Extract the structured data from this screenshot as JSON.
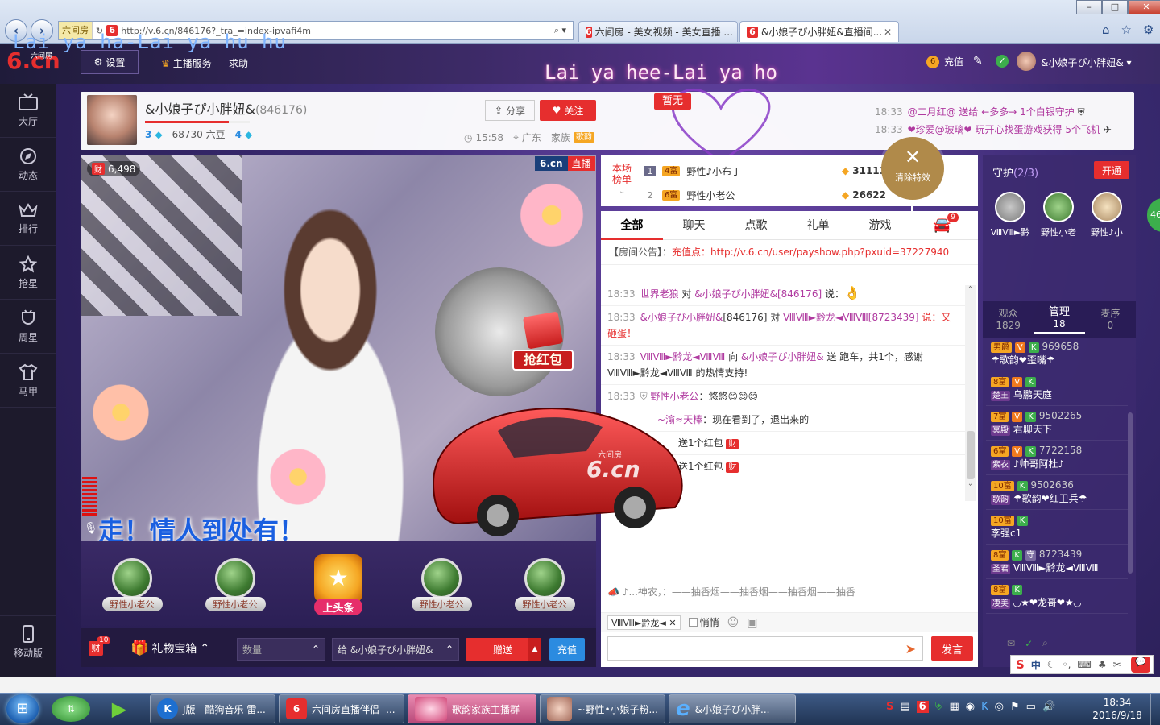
{
  "browser": {
    "address": "http://v.6.cn/846176?_tra_=index-ipvafi4m",
    "badge": "六间房",
    "tabs": [
      {
        "label": "六间房 - 美女视频 - 美女直播 ..."
      },
      {
        "label": "&小娘子ぴ小胖妞&直播间..."
      }
    ]
  },
  "lyrics": {
    "line1": "Lai ya ha-Lai ya hu hu",
    "line2": "Lai ya hee-Lai ya ho"
  },
  "site": {
    "logo_small": "六间房",
    "logo": "6.cn",
    "settings": "设置",
    "anchor_service": "主播服务",
    "help": "求助",
    "recharge": "充值",
    "user": "&小娘子ぴ小胖妞&"
  },
  "leftnav": [
    {
      "label": "大厅",
      "icon": "tv-icon"
    },
    {
      "label": "动态",
      "icon": "compass-icon"
    },
    {
      "label": "排行",
      "icon": "crown-icon"
    },
    {
      "label": "抢星",
      "icon": "star-icon"
    },
    {
      "label": "周星",
      "icon": "cup-icon"
    },
    {
      "label": "马甲",
      "icon": "shirt-icon"
    }
  ],
  "mobile": "移动版",
  "anchor": {
    "name": "&小娘子ぴ小胖妞&",
    "room": "(846176)",
    "level1": "3",
    "beans": "68730 六豆",
    "level2": "4",
    "share": "分享",
    "follow": "关注",
    "time": "15:58",
    "location": "广东",
    "family_label": "家族",
    "family": "歌韵",
    "headline": "暂无",
    "news": [
      {
        "time": "18:33",
        "text": "@二月红@ 送给 ←多多→ 1个白银守护"
      },
      {
        "time": "18:33",
        "text": "❤珍爱@玻璃❤ 玩开心找蛋游戏获得 5个飞机"
      }
    ]
  },
  "video": {
    "coins": "6,498",
    "logo": "6.cn",
    "live": "直播",
    "caption": "走！情人到处有！",
    "red_packet": "抢红包",
    "car_logo": "6.cn",
    "car_sub": "六间房"
  },
  "gifts": {
    "slots": [
      "野性小老公",
      "野性小老公",
      "上头条",
      "野性小老公",
      "野性小老公"
    ],
    "badge": "10",
    "gift_box": "礼物宝箱",
    "qty_placeholder": "数量",
    "to": "给 &小娘子ぴ小胖妞&",
    "send": "赠送",
    "recharge": "充值"
  },
  "rank": {
    "title": "本场榜单",
    "rows": [
      {
        "no": "1",
        "level": "4富",
        "name": "野性♪小布丁",
        "score": "31112"
      },
      {
        "no": "2",
        "level": "6富",
        "name": "野性小老公",
        "score": "26622"
      }
    ],
    "clear": "清除特效"
  },
  "chat": {
    "tabs": [
      "全部",
      "聊天",
      "点歌",
      "礼单",
      "游戏"
    ],
    "car_badge": "9",
    "notice_label": "【房间公告】：",
    "notice_pre": "充值点：",
    "notice_link": "http://v.6.cn/user/payshow.php?pxuid=37227940",
    "messages": [
      {
        "time": "18:33",
        "from": "世界老狼",
        "mid": " 对 ",
        "to": "&小娘子ぴ小胖妞&[846176]",
        "text": " 说："
      },
      {
        "time": "18:33",
        "from": "&小娘子ぴ小胖妞&",
        "mid": "[846176] 对 ",
        "to": "ⅧⅧ►黔龙◄ⅧⅧ[8723439]",
        "text": " 说：又砸蛋！"
      },
      {
        "time": "18:33",
        "from": "ⅧⅧ►黔龙◄ⅧⅧ",
        "mid": " 向 ",
        "to": "&小娘子ぴ小胖妞&",
        "text": " 送 跑车，共1个，感谢 ⅧⅧ►黔龙◄ⅧⅧ 的热情支持!"
      },
      {
        "time": "18:33",
        "from": "野性小老公",
        "mid": "",
        "to": "",
        "text": "：悠悠😊😊😊"
      },
      {
        "time": "",
        "from": "~渝≈天棒",
        "mid": "",
        "to": "",
        "text": "：现在看到了，退出来的"
      },
      {
        "time": "",
        "from": "",
        "mid": "",
        "to": "",
        "text": "送1个红包"
      },
      {
        "time": "",
        "from": "",
        "mid": "",
        "to": "",
        "text": "送1个红包"
      }
    ],
    "marquee": "♪...神农，：——抽香烟——抽香烟——抽香烟——抽香",
    "target": "ⅧⅧ►黔龙◄",
    "whisper": "悄悄",
    "send": "发言"
  },
  "right": {
    "guard_title": "守护",
    "guard_count": "(2/3)",
    "open": "开通",
    "guards": [
      "ⅧⅧ►黔",
      "野性小老",
      "野性♪小"
    ],
    "tabs": [
      {
        "label": "观众",
        "count": "1829"
      },
      {
        "label": "管理",
        "count": "18"
      },
      {
        "label": "麦序",
        "count": "0"
      }
    ],
    "users": [
      {
        "level": "男爵",
        "id": "969658",
        "name": "☂歌韵❤歪嘴☂",
        "fam": ""
      },
      {
        "level": "8富",
        "id": "",
        "name": "乌鹏天庭",
        "fam": "楚王"
      },
      {
        "level": "7富",
        "id": "9502265",
        "name": "君聊天下",
        "fam": "冥殿"
      },
      {
        "level": "6富",
        "id": "7722158",
        "name": "♪帅哥阿杜♪",
        "fam": "紫衣"
      },
      {
        "level": "10富",
        "id": "9502636",
        "name": "☂歌韵❤红卫兵☂",
        "fam": "歌韵"
      },
      {
        "level": "10富",
        "id": "",
        "name": "李强c1",
        "fam": ""
      },
      {
        "level": "8富",
        "id": "8723439",
        "name": "ⅧⅧ►黔龙◄ⅧⅧ",
        "fam": "圣君"
      },
      {
        "level": "8富",
        "id": "",
        "name": "◟◞★❤龙哥❤★◟◞",
        "fam": "凄美"
      }
    ],
    "side_badge": "46"
  },
  "taskbar": {
    "items": [
      "J版 - 酷狗音乐 雷...",
      "六间房直播伴侣 -...",
      "歌韵家族主播群",
      "~野性•小娘子粉...",
      "&小娘子ぴ小胖..."
    ],
    "time": "18:34",
    "date": "2016/9/18",
    "ime": "中"
  },
  "colors": {
    "accent": "#e62e2e",
    "purple": "#3a2a72",
    "magenta": "#b03aa0"
  }
}
